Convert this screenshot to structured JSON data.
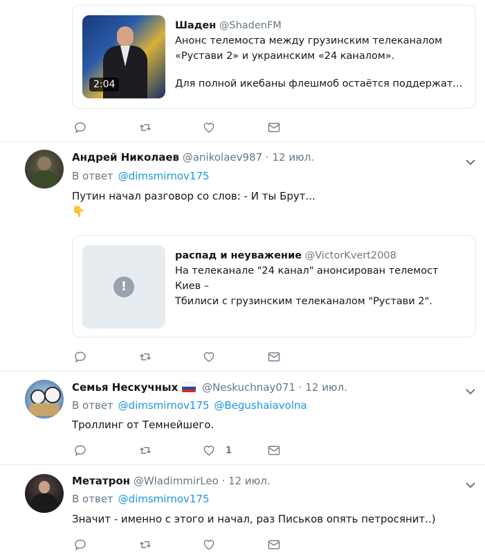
{
  "quoted_video": {
    "name": "Шаден",
    "handle": "@ShadenFM",
    "line1": "Анонс телемоста между грузинским телеканалом",
    "line2": "«Рустави 2» и украинским «24 каналом».",
    "line3": "Для полной икебаны флешмоб остаётся поддержат...",
    "duration": "2:04"
  },
  "tweets": [
    {
      "name": "Андрей Николаев",
      "handle": "@anikolaev987",
      "date": "· 12 июл.",
      "reply_prefix": "В ответ",
      "reply_to": [
        "@dimsmirnov175"
      ],
      "text": "Путин начал разговор со слов: - И ты Брут...",
      "emoji": "👇",
      "quoted": {
        "name": "распад и неуважение",
        "handle": "@VictorKvert2008",
        "line1": "На телеканале \"24 канал\" анонсирован телемост Киев –",
        "line2": "Тбилиси с грузинским телеканалом \"Рустави 2\"."
      },
      "likes": ""
    },
    {
      "name": "Семья Нескучных",
      "handle": "@Neskuchnay071",
      "date": "· 12 июл.",
      "reply_prefix": "В ответ",
      "reply_to": [
        "@dimsmirnov175",
        "@Begushaiavolna"
      ],
      "text": "Троллинг от Темнейшего.",
      "likes": "1"
    },
    {
      "name": "Метатрон",
      "handle": "@WladimmirLeo",
      "date": "· 12 июл.",
      "reply_prefix": "В ответ",
      "reply_to": [
        "@dimsmirnov175"
      ],
      "text": "Значит - именно с этого и начал, раз Письков опять петросянит..)",
      "likes": ""
    }
  ]
}
